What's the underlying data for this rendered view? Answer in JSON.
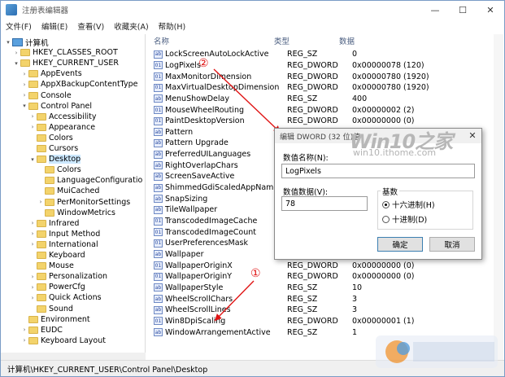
{
  "window": {
    "title": "注册表编辑器"
  },
  "window_controls": {
    "minimize": "—",
    "maximize": "☐",
    "close": "✕"
  },
  "menu": [
    "文件(F)",
    "编辑(E)",
    "查看(V)",
    "收藏夹(A)",
    "帮助(H)"
  ],
  "tree": [
    {
      "label": "计算机",
      "level": 0,
      "arrow": "▾",
      "icon": "computer-icon"
    },
    {
      "label": "HKEY_CLASSES_ROOT",
      "level": 1,
      "arrow": "›",
      "icon": "folder-icon"
    },
    {
      "label": "HKEY_CURRENT_USER",
      "level": 1,
      "arrow": "▾",
      "icon": "folder-icon"
    },
    {
      "label": "AppEvents",
      "level": 2,
      "arrow": "›",
      "icon": "folder-icon"
    },
    {
      "label": "AppXBackupContentType",
      "level": 2,
      "arrow": "›",
      "icon": "folder-icon"
    },
    {
      "label": "Console",
      "level": 2,
      "arrow": "›",
      "icon": "folder-icon"
    },
    {
      "label": "Control Panel",
      "level": 2,
      "arrow": "▾",
      "icon": "folder-icon"
    },
    {
      "label": "Accessibility",
      "level": 3,
      "arrow": "›",
      "icon": "folder-icon"
    },
    {
      "label": "Appearance",
      "level": 3,
      "arrow": "›",
      "icon": "folder-icon"
    },
    {
      "label": "Colors",
      "level": 3,
      "arrow": "",
      "icon": "folder-icon"
    },
    {
      "label": "Cursors",
      "level": 3,
      "arrow": "",
      "icon": "folder-icon"
    },
    {
      "label": "Desktop",
      "level": 3,
      "arrow": "▾",
      "icon": "folder-icon",
      "selected": true
    },
    {
      "label": "Colors",
      "level": 4,
      "arrow": "",
      "icon": "folder-icon"
    },
    {
      "label": "LanguageConfiguratio",
      "level": 4,
      "arrow": "",
      "icon": "folder-icon"
    },
    {
      "label": "MuiCached",
      "level": 4,
      "arrow": "",
      "icon": "folder-icon"
    },
    {
      "label": "PerMonitorSettings",
      "level": 4,
      "arrow": "›",
      "icon": "folder-icon"
    },
    {
      "label": "WindowMetrics",
      "level": 4,
      "arrow": "",
      "icon": "folder-icon"
    },
    {
      "label": "Infrared",
      "level": 3,
      "arrow": "›",
      "icon": "folder-icon"
    },
    {
      "label": "Input Method",
      "level": 3,
      "arrow": "›",
      "icon": "folder-icon"
    },
    {
      "label": "International",
      "level": 3,
      "arrow": "›",
      "icon": "folder-icon"
    },
    {
      "label": "Keyboard",
      "level": 3,
      "arrow": "",
      "icon": "folder-icon"
    },
    {
      "label": "Mouse",
      "level": 3,
      "arrow": "",
      "icon": "folder-icon"
    },
    {
      "label": "Personalization",
      "level": 3,
      "arrow": "›",
      "icon": "folder-icon"
    },
    {
      "label": "PowerCfg",
      "level": 3,
      "arrow": "›",
      "icon": "folder-icon"
    },
    {
      "label": "Quick Actions",
      "level": 3,
      "arrow": "›",
      "icon": "folder-icon"
    },
    {
      "label": "Sound",
      "level": 3,
      "arrow": "",
      "icon": "folder-icon"
    },
    {
      "label": "Environment",
      "level": 2,
      "arrow": "",
      "icon": "folder-icon"
    },
    {
      "label": "EUDC",
      "level": 2,
      "arrow": "›",
      "icon": "folder-icon"
    },
    {
      "label": "Keyboard Layout",
      "level": 2,
      "arrow": "›",
      "icon": "folder-icon"
    }
  ],
  "list": {
    "headers": {
      "name": "名称",
      "type": "类型",
      "data": "数据"
    },
    "rows": [
      {
        "name": "LockScreenAutoLockActive",
        "type": "REG_SZ",
        "data": "0",
        "icon": "ab"
      },
      {
        "name": "LogPixels",
        "type": "REG_DWORD",
        "data": "0x00000078 (120)",
        "icon": "01"
      },
      {
        "name": "MaxMonitorDimension",
        "type": "REG_DWORD",
        "data": "0x00000780 (1920)",
        "icon": "01"
      },
      {
        "name": "MaxVirtualDesktopDimension",
        "type": "REG_DWORD",
        "data": "0x00000780 (1920)",
        "icon": "01"
      },
      {
        "name": "MenuShowDelay",
        "type": "REG_SZ",
        "data": "400",
        "icon": "ab"
      },
      {
        "name": "MouseWheelRouting",
        "type": "REG_DWORD",
        "data": "0x00000002 (2)",
        "icon": "01"
      },
      {
        "name": "PaintDesktopVersion",
        "type": "REG_DWORD",
        "data": "0x00000000 (0)",
        "icon": "01"
      },
      {
        "name": "Pattern",
        "type": "",
        "data": "",
        "icon": "ab"
      },
      {
        "name": "Pattern Upgrade",
        "type": "",
        "data": "",
        "icon": "ab"
      },
      {
        "name": "PreferredUILanguages",
        "type": "",
        "data": "",
        "icon": "ab"
      },
      {
        "name": "RightOverlapChars",
        "type": "",
        "data": "",
        "icon": "ab"
      },
      {
        "name": "ScreenSaveActive",
        "type": "",
        "data": "",
        "icon": "ab"
      },
      {
        "name": "ShimmedGdiScaledAppName",
        "type": "",
        "data": "",
        "icon": "ab"
      },
      {
        "name": "SnapSizing",
        "type": "",
        "data": "",
        "icon": "ab"
      },
      {
        "name": "TileWallpaper",
        "type": "",
        "data": "",
        "icon": "ab"
      },
      {
        "name": "TranscodedImageCache",
        "type": "",
        "data": "",
        "icon": "01"
      },
      {
        "name": "TranscodedImageCount",
        "type": "",
        "data": "",
        "icon": "01"
      },
      {
        "name": "UserPreferencesMask",
        "type": "",
        "data": "",
        "icon": "01"
      },
      {
        "name": "Wallpaper",
        "type": "",
        "data": "",
        "icon": "ab"
      },
      {
        "name": "WallpaperOriginX",
        "type": "REG_DWORD",
        "data": "0x00000000 (0)",
        "icon": "01"
      },
      {
        "name": "WallpaperOriginY",
        "type": "REG_DWORD",
        "data": "0x00000000 (0)",
        "icon": "01"
      },
      {
        "name": "WallpaperStyle",
        "type": "REG_SZ",
        "data": "10",
        "icon": "ab"
      },
      {
        "name": "WheelScrollChars",
        "type": "REG_SZ",
        "data": "3",
        "icon": "ab"
      },
      {
        "name": "WheelScrollLines",
        "type": "REG_SZ",
        "data": "3",
        "icon": "ab"
      },
      {
        "name": "Win8DpiScaling",
        "type": "REG_DWORD",
        "data": "0x00000001 (1)",
        "icon": "01"
      },
      {
        "name": "WindowArrangementActive",
        "type": "REG_SZ",
        "data": "1",
        "icon": "ab"
      }
    ]
  },
  "status": "计算机\\HKEY_CURRENT_USER\\Control Panel\\Desktop",
  "dialog": {
    "title": "编辑 DWORD (32 位)值",
    "close": "✕",
    "name_label": "数值名称(N):",
    "name_value": "LogPixels",
    "data_label": "数值数据(V):",
    "data_value": "78",
    "base_label": "基数",
    "hex_label": "十六进制(H)",
    "dec_label": "十进制(D)",
    "ok": "确定",
    "cancel": "取消"
  },
  "watermark": {
    "brand": "Win10之家",
    "site": "win10.ithome.com"
  },
  "annotations": {
    "one": "①",
    "two": "②"
  },
  "colors": {
    "arrow_red": "#e01515",
    "selection": "#cce8ff",
    "accent": "#3c7fb1"
  }
}
